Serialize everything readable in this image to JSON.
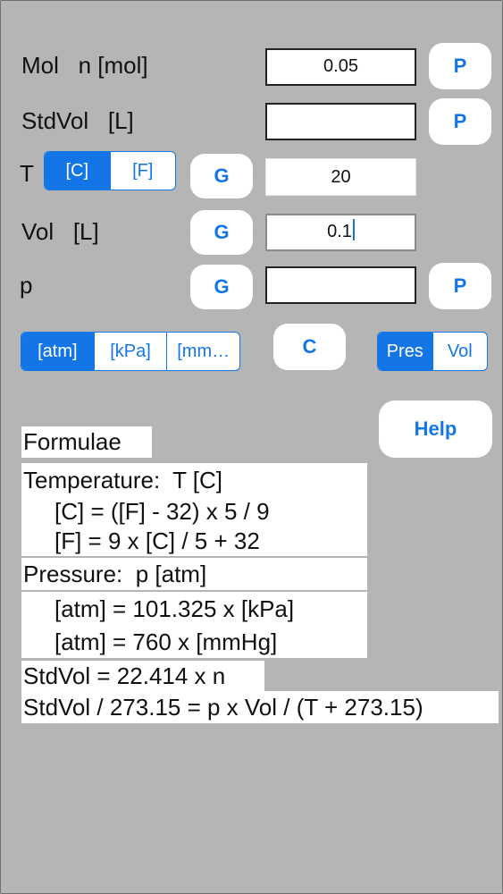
{
  "rows": {
    "mol_label": "Mol   n [mol]",
    "mol_value": "0.05",
    "stdvol_label": "StdVol   [L]",
    "stdvol_value": "",
    "t_label": "T",
    "t_value": "20",
    "vol_label": "Vol   [L]",
    "vol_value": "0.1",
    "p_label": "p",
    "p_value": ""
  },
  "temp_units": {
    "c": "[C]",
    "f": "[F]",
    "selected": "[C]"
  },
  "pressure_units": {
    "atm": "[atm]",
    "kpa": "[kPa]",
    "mmhg": "[mm…",
    "selected": "[atm]"
  },
  "mode_toggle": {
    "pres": "Pres",
    "vol": "Vol",
    "selected": "Pres"
  },
  "buttons": {
    "p": "P",
    "g": "G",
    "c": "C",
    "help": "Help"
  },
  "formulae": {
    "title": "Formulae",
    "temp_heading": "Temperature:  T [C]",
    "temp_eq1": "[C] = ([F] - 32) x 5 / 9",
    "temp_eq2": "[F] = 9 x [C] / 5 + 32",
    "pres_heading": "Pressure:  p [atm]",
    "pres_eq1": "[atm] = 101.325 x [kPa]",
    "pres_eq2": "[atm] = 760 x [mmHg]",
    "stdvol_eq": "StdVol = 22.414 x n",
    "gas_eq": "StdVol / 273.15 = p x Vol / (T + 273.15)"
  },
  "colors": {
    "background": "#b5b5b5",
    "accent": "#1476e6",
    "panel": "#ffffff"
  }
}
